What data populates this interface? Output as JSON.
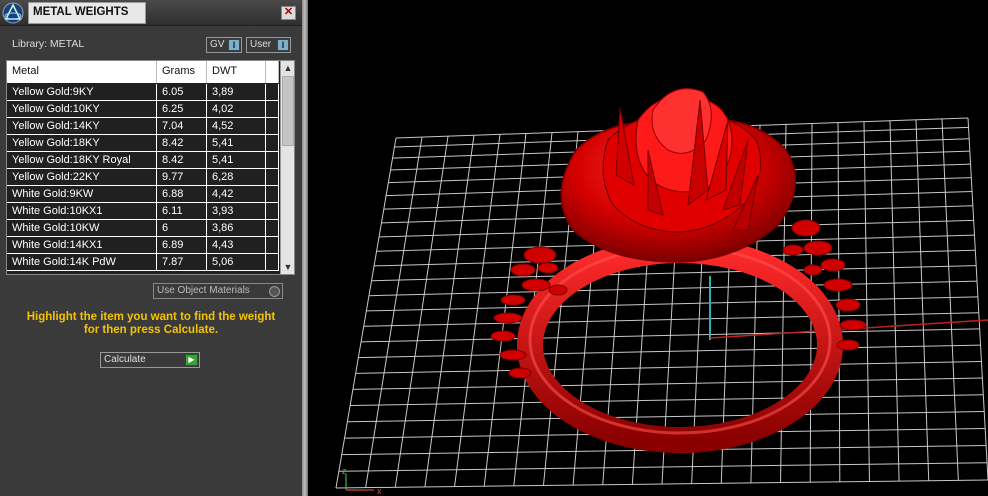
{
  "window": {
    "title": "METAL WEIGHTS",
    "close_glyph": "✕"
  },
  "library": {
    "label": "Library: METAL",
    "buttons": [
      {
        "label": "GV",
        "toggle": "I"
      },
      {
        "label": "User",
        "toggle": "I"
      }
    ]
  },
  "table": {
    "columns": [
      "Metal",
      "Grams",
      "DWT"
    ],
    "rows": [
      {
        "metal": "Yellow Gold:9KY",
        "grams": "6.05",
        "dwt": "3,89"
      },
      {
        "metal": "Yellow Gold:10KY",
        "grams": "6.25",
        "dwt": "4,02"
      },
      {
        "metal": "Yellow Gold:14KY",
        "grams": "7.04",
        "dwt": "4,52"
      },
      {
        "metal": "Yellow Gold:18KY",
        "grams": "8.42",
        "dwt": "5,41"
      },
      {
        "metal": "Yellow Gold:18KY Royal",
        "grams": "8.42",
        "dwt": "5,41"
      },
      {
        "metal": "Yellow Gold:22KY",
        "grams": "9.77",
        "dwt": "6,28"
      },
      {
        "metal": "White Gold:9KW",
        "grams": "6.88",
        "dwt": "4,42"
      },
      {
        "metal": "White Gold:10KX1",
        "grams": "6.11",
        "dwt": "3,93"
      },
      {
        "metal": "White Gold:10KW",
        "grams": "6",
        "dwt": "3,86"
      },
      {
        "metal": "White Gold:14KX1",
        "grams": "6.89",
        "dwt": "4,43"
      },
      {
        "metal": "White Gold:14K PdW",
        "grams": "7.87",
        "dwt": "5,06"
      }
    ]
  },
  "scroll": {
    "up": "▲",
    "down": "▼"
  },
  "use_object_materials": {
    "label": "Use Object Materials"
  },
  "instruction": {
    "line1": "Highlight the item you want to find the weight",
    "line2": "for then press Calculate."
  },
  "calculate": {
    "label": "Calculate",
    "glyph": "▶"
  },
  "viewport": {
    "axis_x_label": "x",
    "axis_z_label": "z",
    "colors": {
      "background": "#000000",
      "grid": "#c8c8c8",
      "ring": "#d80000",
      "x_axis": "#c02020",
      "y_axis": "#2ab3b3"
    }
  },
  "colors": {
    "panel_bg": "#3a3a3a",
    "instruction": "#f5c400",
    "accent_toggle": "#7fb0c8",
    "play_button": "#3aa13a"
  }
}
